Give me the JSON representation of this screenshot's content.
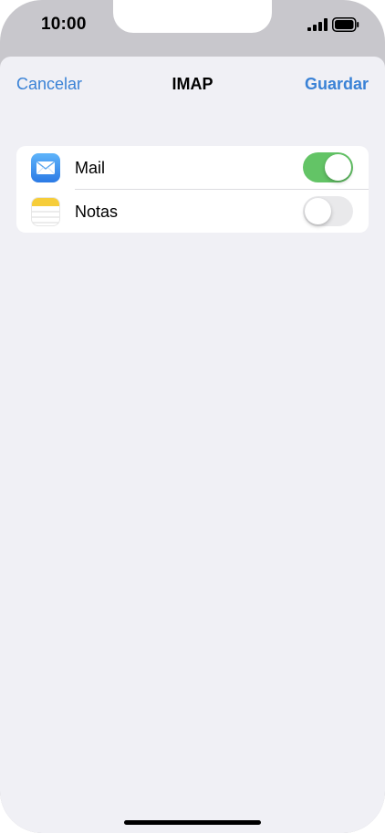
{
  "status_bar": {
    "time": "10:00",
    "signal_icon": "cellular-signal-icon",
    "battery_icon": "battery-icon"
  },
  "nav": {
    "cancel_label": "Cancelar",
    "title": "IMAP",
    "save_label": "Guardar"
  },
  "settings": {
    "items": [
      {
        "label": "Mail",
        "icon": "mail-icon",
        "enabled": true
      },
      {
        "label": "Notas",
        "icon": "notes-icon",
        "enabled": false
      }
    ]
  },
  "colors": {
    "accent": "#3a82d6",
    "toggle_on": "#63c466",
    "toggle_off": "#e9e9eb",
    "background": "#f0f0f5"
  }
}
